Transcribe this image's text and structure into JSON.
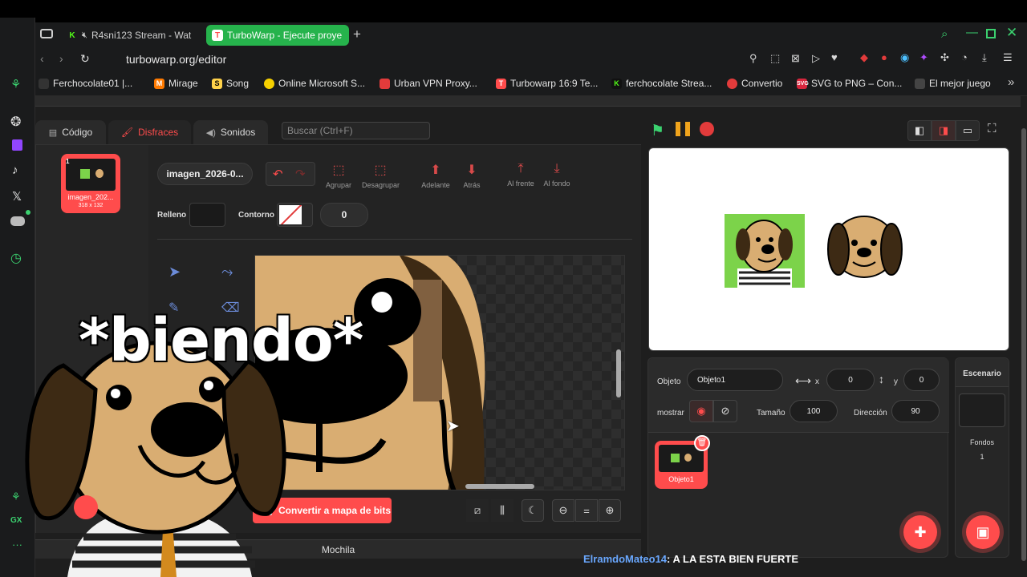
{
  "browser": {
    "tabs": [
      {
        "label": "R4sni123 Stream - Wat",
        "icon": "kick-icon",
        "muted": true
      },
      {
        "label": "TurboWarp - Ejecute proye",
        "icon": "turbowarp-icon",
        "active": true
      }
    ],
    "url": "turbowarp.org/editor",
    "bookmarks": [
      {
        "label": "Ferchocolate01 |...",
        "color": "#ffffff"
      },
      {
        "label": "Mirage",
        "color": "#ff7a00"
      },
      {
        "label": "Song",
        "color": "#ffd24a"
      },
      {
        "label": "Online Microsoft S...",
        "color": "#f6d000"
      },
      {
        "label": "Urban VPN Proxy...",
        "color": "#e23b3b"
      },
      {
        "label": "Turbowarp 16:9 Te...",
        "color": "#ff4c4c"
      },
      {
        "label": "ferchocolate Strea...",
        "color": "#53fc18"
      },
      {
        "label": "Convertio",
        "color": "#e23b3b"
      },
      {
        "label": "SVG to PNG – Con...",
        "color": "#d7263d"
      },
      {
        "label": "El mejor juego",
        "color": "#ffffff"
      }
    ],
    "accent": "#26b34c"
  },
  "editor": {
    "tabs": {
      "code": "Código",
      "costumes": "Disfraces",
      "sounds": "Sonidos"
    },
    "search_placeholder": "Buscar (Ctrl+F)",
    "costume": {
      "index": "1",
      "name": "imagen_202...",
      "size": "318 x 132"
    },
    "costume_name_field": "imagen_2026-0...",
    "toolbar": {
      "group": "Agrupar",
      "ungroup": "Desagrupar",
      "forward": "Adelante",
      "backward": "Atrás",
      "front": "Al frente",
      "back": "Al fondo"
    },
    "fill_label": "Relleno",
    "outline_label": "Contorno",
    "outline_width": "0",
    "convert_button": "Convertir a mapa de bits",
    "backpack": "Mochila",
    "accent": "#ff4c4c"
  },
  "sprite": {
    "object_label": "Objeto",
    "name": "Objeto1",
    "x_label": "x",
    "x": "0",
    "y_label": "y",
    "y": "0",
    "show_label": "mostrar",
    "size_label": "Tamaño",
    "size": "100",
    "direction_label": "Dirección",
    "direction": "90",
    "tile_name": "Objeto1"
  },
  "stage_pane": {
    "title": "Escenario",
    "backdrops_label": "Fondos",
    "backdrops_count": "1"
  },
  "overlay": {
    "caption": "*biendo*"
  },
  "chat": {
    "user": "ElramdoMateo14",
    "message": ": A LA ESTA BIEN FUERTE",
    "user_color": "#6aa8ff"
  }
}
